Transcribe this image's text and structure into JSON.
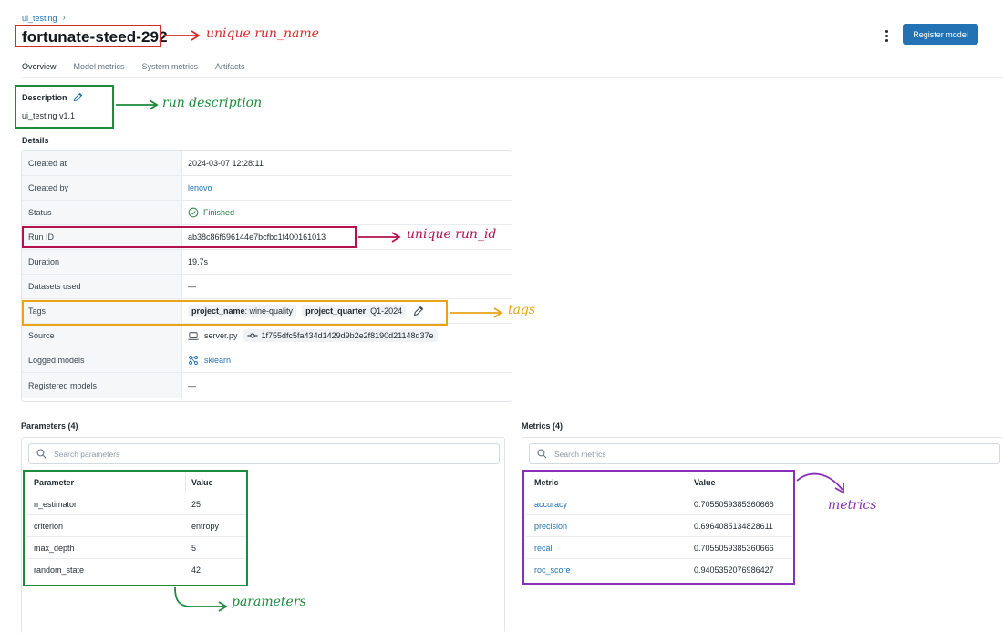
{
  "breadcrumb": {
    "experiment": "ui_testing",
    "separator": "›"
  },
  "header": {
    "run_name": "fortunate-steed-292",
    "register_label": "Register model"
  },
  "tabs": [
    {
      "label": "Overview",
      "active": true
    },
    {
      "label": "Model metrics",
      "active": false
    },
    {
      "label": "System metrics",
      "active": false
    },
    {
      "label": "Artifacts",
      "active": false
    }
  ],
  "description": {
    "label": "Description",
    "value": "ui_testing v1.1"
  },
  "details": {
    "label": "Details",
    "created_at": {
      "key": "Created at",
      "value": "2024-03-07 12:28:11"
    },
    "created_by": {
      "key": "Created by",
      "value": "lenovo"
    },
    "status": {
      "key": "Status",
      "value": "Finished"
    },
    "run_id": {
      "key": "Run ID",
      "value": "ab38c86f696144e7bcfbc1f400161013"
    },
    "duration": {
      "key": "Duration",
      "value": "19.7s"
    },
    "datasets": {
      "key": "Datasets used",
      "value": "—"
    },
    "tags": {
      "key": "Tags",
      "items": [
        {
          "name": "project_name",
          "value": ": wine-quality"
        },
        {
          "name": "project_quarter",
          "value": ": Q1-2024"
        }
      ]
    },
    "source": {
      "key": "Source",
      "file": "server.py",
      "commit": "1f755dfc5fa434d1429d9b2e2f8190d21148d37e"
    },
    "logged_models": {
      "key": "Logged models",
      "value": "sklearn"
    },
    "registered_models": {
      "key": "Registered models",
      "value": "—"
    }
  },
  "parameters": {
    "label": "Parameters (4)",
    "search_placeholder": "Search parameters",
    "columns": [
      "Parameter",
      "Value"
    ],
    "rows": [
      [
        "n_estimator",
        "25"
      ],
      [
        "criterion",
        "entropy"
      ],
      [
        "max_depth",
        "5"
      ],
      [
        "random_state",
        "42"
      ]
    ]
  },
  "metrics": {
    "label": "Metrics (4)",
    "search_placeholder": "Search metrics",
    "columns": [
      "Metric",
      "Value"
    ],
    "rows": [
      [
        "accuracy",
        "0.7055059385360666"
      ],
      [
        "precision",
        "0.6964085134828611"
      ],
      [
        "recall",
        "0.7055059385360666"
      ],
      [
        "roc_score",
        "0.9405352076986427"
      ]
    ]
  },
  "annotations": {
    "run_name": "unique run_name",
    "description": "run description",
    "run_id": "unique run_id",
    "tags": "tags",
    "metrics": "metrics",
    "parameters": "parameters"
  },
  "colors": {
    "accent": "#2272b4",
    "status_ok": "#277c43",
    "annot_red": "#d42b2b",
    "annot_green": "#1e8a3c",
    "annot_crimson": "#b3124f",
    "annot_orange": "#e8a317",
    "annot_purple": "#8b2fb8"
  },
  "icons": [
    "chevron-right-icon",
    "kebab-menu-icon",
    "pencil-icon",
    "check-circle-icon",
    "laptop-icon",
    "git-commit-icon",
    "model-icon",
    "search-icon",
    "arrow-icon"
  ]
}
